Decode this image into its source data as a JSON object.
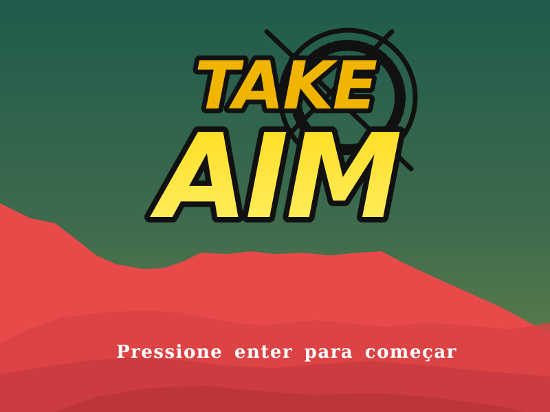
{
  "game": {
    "title_line1": "TAKE",
    "title_line2": "AIM",
    "prompt": "Pressione enter para começar"
  },
  "colors": {
    "sky_top": "#1f5d4c",
    "sky_bottom": "#5e7f4b",
    "mountain_front": "#e84a4a",
    "mountain_shadow": "#cf3e40",
    "logo_yellow": "#ffd400",
    "logo_outline": "#111111"
  },
  "icons": {
    "crosshair": "crosshair-icon"
  }
}
